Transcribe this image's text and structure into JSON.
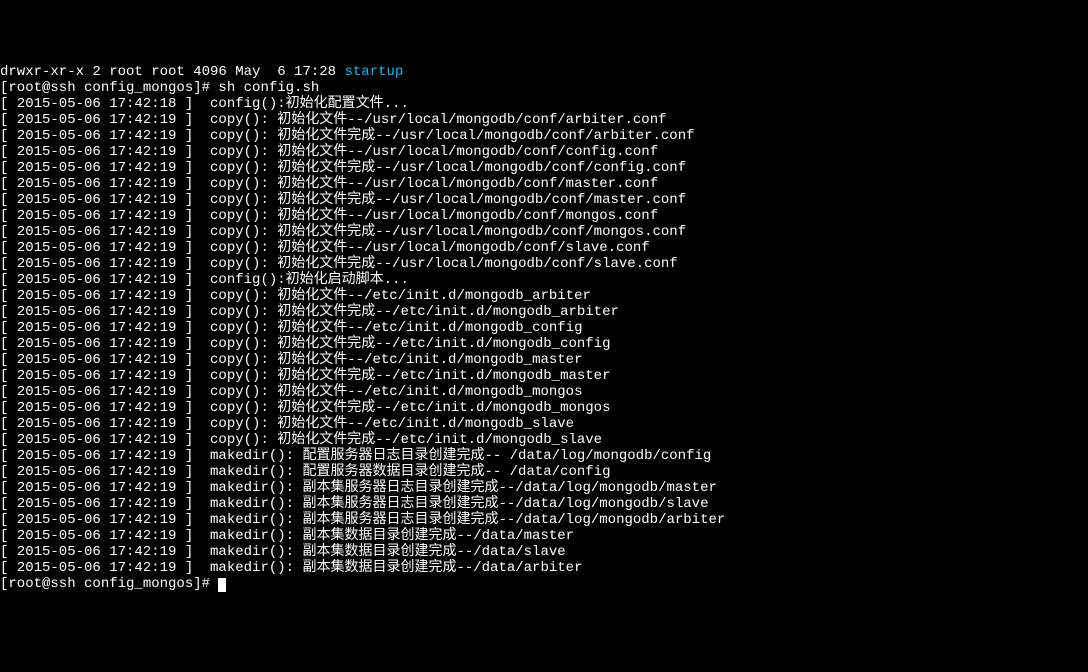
{
  "lines": [
    {
      "text": "drwxr-xr-x 2 root root 4096 May  6 17:28 ",
      "suffix": "startup",
      "suffixClass": "cyan"
    },
    {
      "text": "[root@ssh config_mongos]# sh config.sh"
    },
    {
      "text": "[ 2015-05-06 17:42:18 ]  config():初始化配置文件..."
    },
    {
      "text": "[ 2015-05-06 17:42:19 ]  copy(): 初始化文件--/usr/local/mongodb/conf/arbiter.conf"
    },
    {
      "text": "[ 2015-05-06 17:42:19 ]  copy(): 初始化文件完成--/usr/local/mongodb/conf/arbiter.conf"
    },
    {
      "text": "[ 2015-05-06 17:42:19 ]  copy(): 初始化文件--/usr/local/mongodb/conf/config.conf"
    },
    {
      "text": "[ 2015-05-06 17:42:19 ]  copy(): 初始化文件完成--/usr/local/mongodb/conf/config.conf"
    },
    {
      "text": "[ 2015-05-06 17:42:19 ]  copy(): 初始化文件--/usr/local/mongodb/conf/master.conf"
    },
    {
      "text": "[ 2015-05-06 17:42:19 ]  copy(): 初始化文件完成--/usr/local/mongodb/conf/master.conf"
    },
    {
      "text": "[ 2015-05-06 17:42:19 ]  copy(): 初始化文件--/usr/local/mongodb/conf/mongos.conf"
    },
    {
      "text": "[ 2015-05-06 17:42:19 ]  copy(): 初始化文件完成--/usr/local/mongodb/conf/mongos.conf"
    },
    {
      "text": "[ 2015-05-06 17:42:19 ]  copy(): 初始化文件--/usr/local/mongodb/conf/slave.conf"
    },
    {
      "text": "[ 2015-05-06 17:42:19 ]  copy(): 初始化文件完成--/usr/local/mongodb/conf/slave.conf"
    },
    {
      "text": "[ 2015-05-06 17:42:19 ]  config():初始化启动脚本..."
    },
    {
      "text": "[ 2015-05-06 17:42:19 ]  copy(): 初始化文件--/etc/init.d/mongodb_arbiter"
    },
    {
      "text": "[ 2015-05-06 17:42:19 ]  copy(): 初始化文件完成--/etc/init.d/mongodb_arbiter"
    },
    {
      "text": "[ 2015-05-06 17:42:19 ]  copy(): 初始化文件--/etc/init.d/mongodb_config"
    },
    {
      "text": "[ 2015-05-06 17:42:19 ]  copy(): 初始化文件完成--/etc/init.d/mongodb_config"
    },
    {
      "text": "[ 2015-05-06 17:42:19 ]  copy(): 初始化文件--/etc/init.d/mongodb_master"
    },
    {
      "text": "[ 2015-05-06 17:42:19 ]  copy(): 初始化文件完成--/etc/init.d/mongodb_master"
    },
    {
      "text": "[ 2015-05-06 17:42:19 ]  copy(): 初始化文件--/etc/init.d/mongodb_mongos"
    },
    {
      "text": "[ 2015-05-06 17:42:19 ]  copy(): 初始化文件完成--/etc/init.d/mongodb_mongos"
    },
    {
      "text": "[ 2015-05-06 17:42:19 ]  copy(): 初始化文件--/etc/init.d/mongodb_slave"
    },
    {
      "text": "[ 2015-05-06 17:42:19 ]  copy(): 初始化文件完成--/etc/init.d/mongodb_slave"
    },
    {
      "text": "[ 2015-05-06 17:42:19 ]  makedir(): 配置服务器日志目录创建完成-- /data/log/mongodb/config"
    },
    {
      "text": "[ 2015-05-06 17:42:19 ]  makedir(): 配置服务器数据目录创建完成-- /data/config"
    },
    {
      "text": "[ 2015-05-06 17:42:19 ]  makedir(): 副本集服务器日志目录创建完成--/data/log/mongodb/master"
    },
    {
      "text": "[ 2015-05-06 17:42:19 ]  makedir(): 副本集服务器日志目录创建完成--/data/log/mongodb/slave"
    },
    {
      "text": "[ 2015-05-06 17:42:19 ]  makedir(): 副本集服务器日志目录创建完成--/data/log/mongodb/arbiter"
    },
    {
      "text": "[ 2015-05-06 17:42:19 ]  makedir(): 副本集数据目录创建完成--/data/master"
    },
    {
      "text": "[ 2015-05-06 17:42:19 ]  makedir(): 副本集数据目录创建完成--/data/slave"
    },
    {
      "text": "[ 2015-05-06 17:42:19 ]  makedir(): 副本集数据目录创建完成--/data/arbiter"
    }
  ],
  "prompt": "[root@ssh config_mongos]#"
}
